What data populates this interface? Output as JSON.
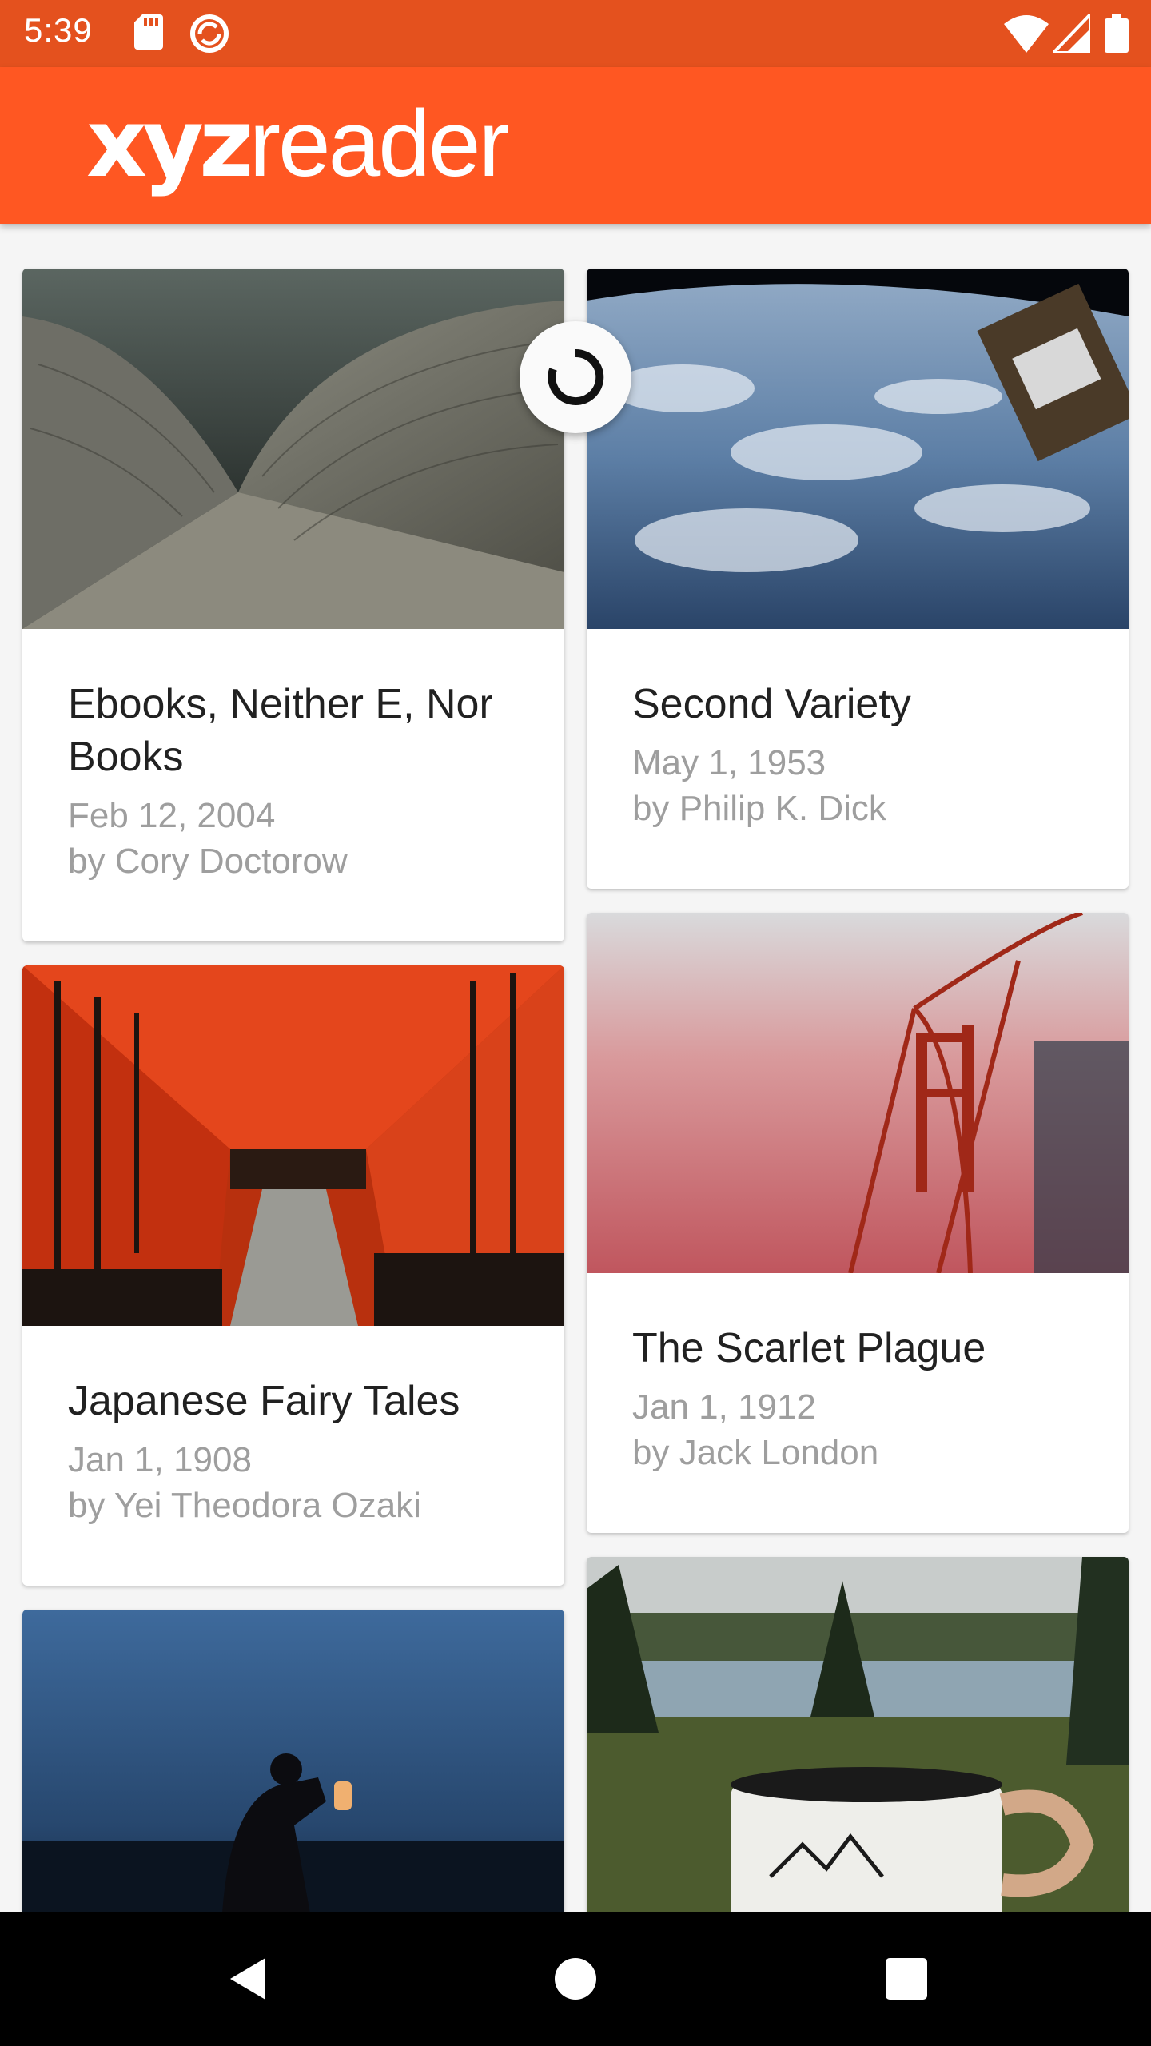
{
  "status_bar": {
    "time": "5:39",
    "icons": [
      "sdcard-icon",
      "sync-icon",
      "wifi-icon",
      "signal-icon",
      "battery-icon"
    ]
  },
  "app_bar": {
    "logo_bold": "xyz",
    "logo_light": "reader",
    "color": "#ff5722"
  },
  "articles": [
    {
      "title": "Ebooks, Neither E, Nor Books",
      "date": "Feb 12, 2004",
      "author": "by Cory Doctorow"
    },
    {
      "title": "Second Variety",
      "date": "May 1, 1953",
      "author": "by Philip K. Dick"
    },
    {
      "title": "Japanese Fairy Tales",
      "date": "Jan 1, 1908",
      "author": "by Yei Theodora Ozaki"
    },
    {
      "title": "The Scarlet Plague",
      "date": "Jan 1, 1912",
      "author": "by Jack London"
    },
    {
      "title": "",
      "date": "",
      "author": ""
    },
    {
      "title": "",
      "date": "",
      "author": ""
    }
  ],
  "nav_bar": {
    "icons": [
      "back-icon",
      "home-icon",
      "recents-icon"
    ]
  }
}
